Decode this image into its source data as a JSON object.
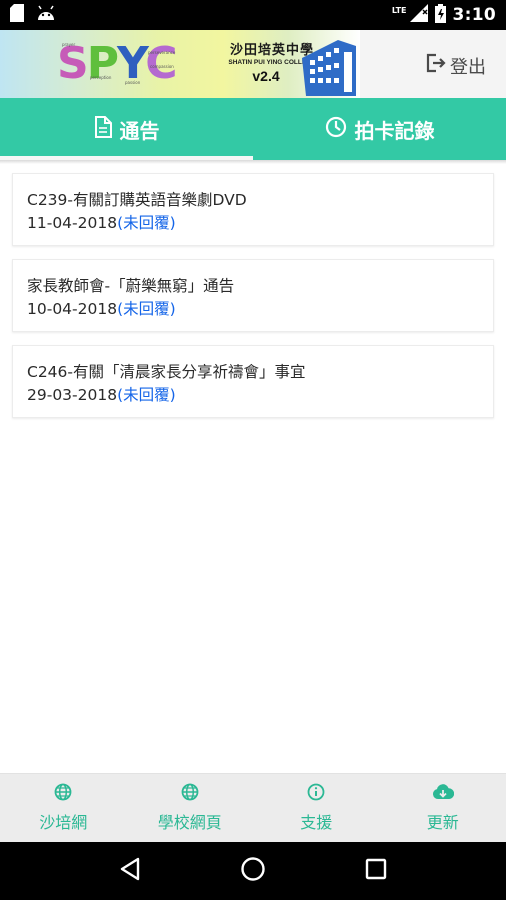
{
  "status_bar": {
    "network": "LTE",
    "time": "3:10",
    "icons": [
      "sd-card-icon",
      "android-icon",
      "signal-icon",
      "battery-icon"
    ]
  },
  "header": {
    "app_logo": "SPYC",
    "school_name_cn": "沙田培英中學",
    "school_name_en": "SHATIN PUI YING COLLEGE",
    "version": "v2.4",
    "logout_label": "登出"
  },
  "tabs": [
    {
      "label": "通告",
      "icon": "document-icon",
      "active": true
    },
    {
      "label": "拍卡記錄",
      "icon": "clock-icon",
      "active": false
    }
  ],
  "notices": [
    {
      "title": "C239-有關訂購英語音樂劇DVD",
      "date": "11-04-2018",
      "status": "(未回覆)"
    },
    {
      "title": "家長教師會-「蔚樂無窮」通告",
      "date": "10-04-2018",
      "status": "(未回覆)"
    },
    {
      "title": "C246-有關「清晨家長分享祈禱會」事宜",
      "date": "29-03-2018",
      "status": "(未回覆)"
    }
  ],
  "bottom_nav": [
    {
      "label": "沙培網",
      "icon": "globe-icon"
    },
    {
      "label": "學校網頁",
      "icon": "globe-icon"
    },
    {
      "label": "支援",
      "icon": "info-icon"
    },
    {
      "label": "更新",
      "icon": "cloud-download-icon"
    }
  ],
  "colors": {
    "accent": "#33c9a5",
    "nav_text": "#2bb894",
    "status_link": "#1565e8"
  }
}
